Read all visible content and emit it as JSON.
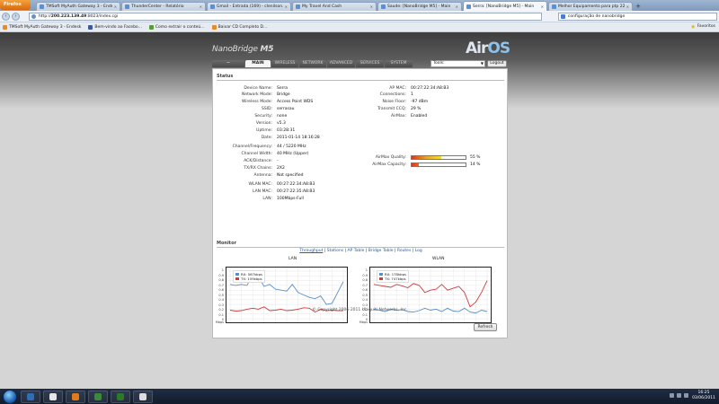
{
  "browser": {
    "app_button": "Firefox",
    "tabs": [
      {
        "label": "TMSoft MyAuth Gateway 3 - Endesk",
        "active": false
      },
      {
        "label": "ThunderCenter - Relatório",
        "active": false
      },
      {
        "label": "Gmail - Entrada (169) - clenilson.m...",
        "active": false
      },
      {
        "label": "My Travel And Cash",
        "active": false
      },
      {
        "label": "Saude: [NanoBridge M5] - Main",
        "active": false
      },
      {
        "label": "Serra: [NanoBridge M5] - Main",
        "active": true
      },
      {
        "label": "Melhor Equipamento para ptp 22k...",
        "active": false
      }
    ],
    "url_prefix": "http://",
    "url_host": "200.223.139.49",
    "url_rest": ":8023/index.cgi",
    "search_value": "configuração de nanobridge",
    "bookmarks": [
      "TMSoft MyAuth Gateway 3 - Endesk",
      "Bem-vindo ao Facebo...",
      "Como extrair o conteú...",
      "Baixar CD Completo D..."
    ],
    "favorites_label": "Favoritos"
  },
  "app": {
    "brand_name": "NanoBridge",
    "brand_model": "M5",
    "logo_air": "Air",
    "logo_os": "OS",
    "logo_tab": "~",
    "tabs": [
      "MAIN",
      "WIRELESS",
      "NETWORK",
      "ADVANCED",
      "SERVICES",
      "SYSTEM"
    ],
    "active_tab": "MAIN",
    "tools_label": "Tools:",
    "logout_label": "Logout"
  },
  "status": {
    "heading": "Status",
    "left": [
      {
        "label": "Device Name:",
        "value": "Serra"
      },
      {
        "label": "Network Mode:",
        "value": "Bridge"
      },
      {
        "label": "Wireless Mode:",
        "value": "Access Point WDS"
      },
      {
        "label": "SSID:",
        "value": "serrasau"
      },
      {
        "label": "Security:",
        "value": "none"
      },
      {
        "label": "Version:",
        "value": "v5.3"
      },
      {
        "label": "Uptime:",
        "value": "03:28:31"
      },
      {
        "label": "Date:",
        "value": "2011-01-14 18:16:28"
      },
      {
        "label": "Channel/Frequency:",
        "value": "44 / 5220 MHz"
      },
      {
        "label": "Channel Width:",
        "value": "40 MHz (Upper)"
      },
      {
        "label": "ACK/Distance:",
        "value": "-"
      },
      {
        "label": "TX/RX Chains:",
        "value": "2X2"
      },
      {
        "label": "Antenna:",
        "value": "Not specified"
      },
      {
        "label": "WLAN MAC:",
        "value": "00:27:22:34:A8:B3"
      },
      {
        "label": "LAN MAC:",
        "value": "00:27:22:35:A8:B3"
      },
      {
        "label": "LAN:",
        "value": "100Mbps-Full"
      }
    ],
    "right": [
      {
        "label": "AP MAC:",
        "value": "00:27:22:34:A8:B3"
      },
      {
        "label": "Connections:",
        "value": "1"
      },
      {
        "label": "Noise Floor:",
        "value": "-97 dBm"
      },
      {
        "label": "Transmit CCQ:",
        "value": "29 %"
      },
      {
        "label": "AirMax:",
        "value": "Enabled"
      }
    ],
    "airmax_quality": {
      "label": "AirMax Quality:",
      "percent": 55,
      "text": "55 %"
    },
    "airmax_capacity": {
      "label": "AirMax Capacity:",
      "percent": 14,
      "text": "14 %"
    }
  },
  "monitor": {
    "heading": "Monitor",
    "links": [
      "Throughput",
      "Stations",
      "AP Table",
      "Bridge Table",
      "Routes",
      "Log"
    ],
    "active_link": "Throughput",
    "refresh_label": "Refresh"
  },
  "chart_data": [
    {
      "type": "line",
      "title": "LAN",
      "ylabel": "Mbps",
      "ylim": [
        0,
        1
      ],
      "yticks": [
        "1",
        "0.9",
        "0.8",
        "0.7",
        "0.6",
        "0.5",
        "0.4",
        "0.3",
        "0.2",
        "0.1",
        "0"
      ],
      "grid": true,
      "legend_position": "top-left",
      "series": [
        {
          "name": "RX: 567kbps",
          "color": "#5b8fc7",
          "values": [
            0.72,
            0.7,
            0.72,
            0.7,
            0.95,
            0.88,
            0.68,
            0.72,
            0.62,
            0.6,
            0.58,
            0.72,
            0.55,
            0.5,
            0.45,
            0.42,
            0.48,
            0.3,
            0.32,
            0.55,
            0.78
          ]
        },
        {
          "name": "TX: 159kbps",
          "color": "#d23b3b",
          "values": [
            0.18,
            0.16,
            0.17,
            0.2,
            0.22,
            0.2,
            0.25,
            0.17,
            0.18,
            0.2,
            0.17,
            0.18,
            0.2,
            0.23,
            0.22,
            0.14,
            0.2,
            0.17,
            0.18,
            0.17,
            0.17
          ]
        }
      ]
    },
    {
      "type": "line",
      "title": "WLAN",
      "ylabel": "Mbps",
      "ylim": [
        0,
        1
      ],
      "yticks": [
        "1",
        "0.9",
        "0.8",
        "0.7",
        "0.6",
        "0.5",
        "0.4",
        "0.3",
        "0.2",
        "0.1",
        "0"
      ],
      "grid": true,
      "legend_position": "top-left",
      "series": [
        {
          "name": "RX: 178kbps",
          "color": "#5b8fc7",
          "values": [
            0.2,
            0.18,
            0.15,
            0.2,
            0.18,
            0.19,
            0.15,
            0.14,
            0.17,
            0.22,
            0.18,
            0.2,
            0.15,
            0.22,
            0.16,
            0.15,
            0.22,
            0.14,
            0.12,
            0.18,
            0.15
          ]
        },
        {
          "name": "TX: 747kbps",
          "color": "#d23b3b",
          "values": [
            0.72,
            0.7,
            0.68,
            0.66,
            0.72,
            0.69,
            0.65,
            0.74,
            0.7,
            0.55,
            0.6,
            0.62,
            0.72,
            0.6,
            0.64,
            0.68,
            0.55,
            0.25,
            0.35,
            0.55,
            0.8
          ]
        }
      ]
    }
  ],
  "footer": {
    "copyright": "© Copyright 2006-2011 Ubiquiti Networks, Inc."
  },
  "taskbar": {
    "time": "16:25",
    "date": "03/06/2011",
    "icon_colors": [
      "#2f6db5",
      "#e6e6e6",
      "#e07b1b",
      "#3a8a3a",
      "#2a7a2a",
      "#dcdcdc"
    ]
  }
}
